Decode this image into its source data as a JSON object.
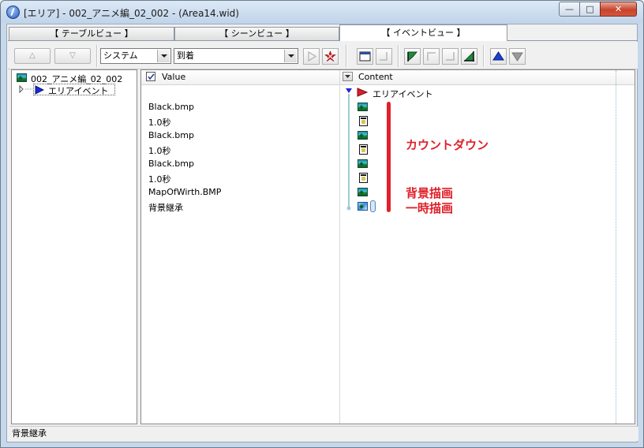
{
  "window": {
    "title": "[エリア] - 002_アニメ編_02_002 - (Area14.wid)"
  },
  "window_buttons": {
    "minimize": "—",
    "maximize": "□",
    "close": "✕"
  },
  "tabs": [
    {
      "label": "【 テーブルビュー 】"
    },
    {
      "label": "【 シーンビュー 】"
    },
    {
      "label": "【 イベントビュー 】"
    }
  ],
  "toolbar": {
    "up_arrow": "△",
    "down_arrow": "▽",
    "category_select": "システム",
    "event_select": "到着"
  },
  "tree": {
    "root_label": "002_アニメ編_02_002",
    "child_label": "エリアイベント"
  },
  "table": {
    "col_value": "Value",
    "col_content": "Content",
    "rows": [
      {
        "value": "Black.bmp",
        "icon": "image-icon"
      },
      {
        "value": "1.0秒",
        "icon": "hourglass-icon"
      },
      {
        "value": "Black.bmp",
        "icon": "image-icon"
      },
      {
        "value": "1.0秒",
        "icon": "hourglass-icon"
      },
      {
        "value": "Black.bmp",
        "icon": "image-icon"
      },
      {
        "value": "1.0秒",
        "icon": "hourglass-icon"
      },
      {
        "value": "MapOfWirth.BMP",
        "icon": "image-icon"
      },
      {
        "value": "背景継承",
        "icon": "inherit-image-icon"
      }
    ],
    "root_event_label": "エリアイベント"
  },
  "annotations": {
    "countdown": "カウントダウン",
    "background_draw": "背景描画",
    "temp_draw": "一時描画",
    "color": "#e0202a"
  },
  "status_bar": {
    "text": "背景継承"
  }
}
